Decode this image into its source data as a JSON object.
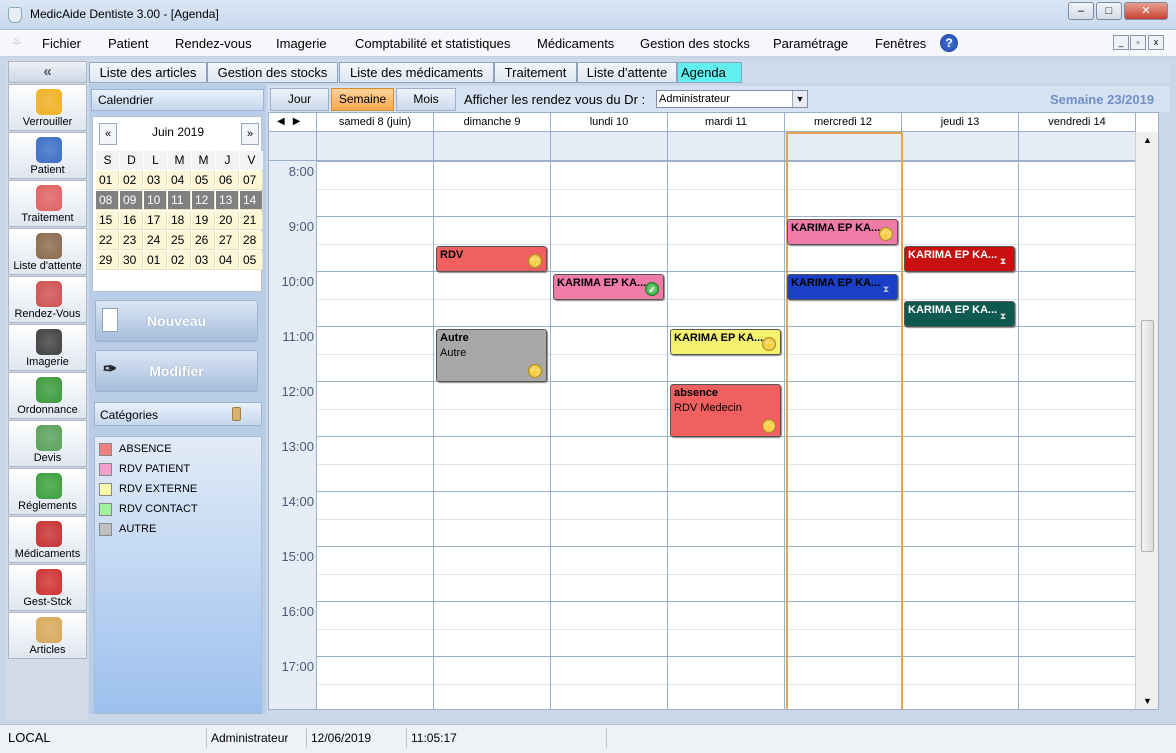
{
  "window": {
    "title": "MedicAide Dentiste 3.00  - [Agenda]",
    "min": "–",
    "max": "□",
    "close": "✕"
  },
  "menu": {
    "items": [
      "Fichier",
      "Patient",
      "Rendez-vous",
      "Imagerie",
      "Comptabilité et statistiques",
      "Médicaments",
      "Gestion des stocks",
      "Paramétrage",
      "Fenêtres"
    ],
    "help": "?",
    "mdi_min": "_",
    "mdi_restore": "▫",
    "mdi_close": "x"
  },
  "sidebar": {
    "collapse": "«",
    "items": [
      {
        "label": "Verrouiller",
        "icon": "lock-icon",
        "color": "#f0b020"
      },
      {
        "label": "Patient",
        "icon": "patient-icon",
        "color": "#3a6ec4"
      },
      {
        "label": "Traitement",
        "icon": "doctor-icon",
        "color": "#e06060"
      },
      {
        "label": "Liste d'attente",
        "icon": "hourglass-icon",
        "color": "#8a6a4a"
      },
      {
        "label": "Rendez-Vous",
        "icon": "calendar-clock-icon",
        "color": "#d05050"
      },
      {
        "label": "Imagerie",
        "icon": "film-icon",
        "color": "#404040"
      },
      {
        "label": "Ordonnance",
        "icon": "caduceus-icon",
        "color": "#3a9a3a"
      },
      {
        "label": "Devis",
        "icon": "quote-icon",
        "color": "#5aa05a"
      },
      {
        "label": "Réglements",
        "icon": "money-icon",
        "color": "#3aa03a"
      },
      {
        "label": "Médicaments",
        "icon": "medicine-book-icon",
        "color": "#c83030"
      },
      {
        "label": "Gest-Stck",
        "icon": "recycle-icon",
        "color": "#d03030"
      },
      {
        "label": "Articles",
        "icon": "box-icon",
        "color": "#d8a858"
      }
    ]
  },
  "tabs": [
    {
      "label": "Liste des articles"
    },
    {
      "label": "Gestion des stocks"
    },
    {
      "label": "Liste des médicaments"
    },
    {
      "label": "Traitement"
    },
    {
      "label": "Liste d'attente"
    },
    {
      "label": "Agenda",
      "active": true
    }
  ],
  "calendar": {
    "header": "Calendrier",
    "prev": "«",
    "next": "»",
    "month": "Juin 2019",
    "weekdays": [
      "S",
      "D",
      "L",
      "M",
      "M",
      "J",
      "V"
    ],
    "weeks": [
      [
        "01",
        "02",
        "03",
        "04",
        "05",
        "06",
        "07"
      ],
      [
        "08",
        "09",
        "10",
        "11",
        "12",
        "13",
        "14"
      ],
      [
        "15",
        "16",
        "17",
        "18",
        "19",
        "20",
        "21"
      ],
      [
        "22",
        "23",
        "24",
        "25",
        "26",
        "27",
        "28"
      ],
      [
        "29",
        "30",
        "01",
        "02",
        "03",
        "04",
        "05"
      ]
    ],
    "selected_week": 1
  },
  "buttons": {
    "new": "Nouveau",
    "edit": "Modifier"
  },
  "categories": {
    "header": "Catégories",
    "items": [
      {
        "label": "ABSENCE",
        "color": "#f08080"
      },
      {
        "label": "RDV PATIENT",
        "color": "#f4a0cc"
      },
      {
        "label": "RDV EXTERNE",
        "color": "#fafaaa"
      },
      {
        "label": "RDV CONTACT",
        "color": "#a0f0a0"
      },
      {
        "label": "AUTRE",
        "color": "#c0c0c0"
      }
    ]
  },
  "views": {
    "day": "Jour",
    "week": "Semaine",
    "month": "Mois",
    "active": "week"
  },
  "doctor": {
    "label": "Afficher les rendez vous du Dr :",
    "value": "Administrateur"
  },
  "week_label": "Semaine 23/2019",
  "agenda": {
    "nav": "◀▶",
    "days": [
      "samedi 8 (juin)",
      "dimanche 9",
      "lundi 10",
      "mardi 11",
      "mercredi 12",
      "jeudi 13",
      "vendredi 14"
    ],
    "today_index": 4,
    "hours": [
      "8:00",
      "9:00",
      "10:00",
      "11:00",
      "12:00",
      "13:00",
      "14:00",
      "15:00",
      "16:00",
      "17:00"
    ],
    "start_hour": 7.5,
    "appointments": [
      {
        "day": 1,
        "start": 9.5,
        "end": 10.0,
        "title": "RDV",
        "subtitle": "",
        "color": "#f06060",
        "status": "clock",
        "text_color": "#000"
      },
      {
        "day": 1,
        "start": 11.0,
        "end": 12.0,
        "title": "Autre",
        "subtitle": "Autre",
        "color": "#a8a8a8",
        "status": "clock",
        "text_color": "#000"
      },
      {
        "day": 2,
        "start": 10.0,
        "end": 10.5,
        "title": "KARIMA EP KA...",
        "subtitle": "",
        "color": "#f07aa8",
        "status": "check",
        "text_color": "#000"
      },
      {
        "day": 3,
        "start": 11.0,
        "end": 11.5,
        "title": "KARIMA EP KA...",
        "subtitle": "",
        "color": "#f4f070",
        "status": "clock",
        "text_color": "#000"
      },
      {
        "day": 3,
        "start": 12.0,
        "end": 13.0,
        "title": "absence",
        "subtitle": "RDV Medecin",
        "color": "#f06060",
        "status": "clock",
        "text_color": "#000"
      },
      {
        "day": 4,
        "start": 9.0,
        "end": 9.5,
        "title": "KARIMA EP KA...",
        "subtitle": "",
        "color": "#f07aa8",
        "status": "clock",
        "text_color": "#000"
      },
      {
        "day": 4,
        "start": 10.0,
        "end": 10.5,
        "title": "KARIMA EP KA...",
        "subtitle": "",
        "color": "#1a40c8",
        "status": "hourglass",
        "text_color": "#000"
      },
      {
        "day": 5,
        "start": 9.5,
        "end": 10.0,
        "title": "KARIMA EP KA...",
        "subtitle": "",
        "color": "#c81010",
        "status": "hourglass",
        "text_color": "#fff"
      },
      {
        "day": 5,
        "start": 10.5,
        "end": 11.0,
        "title": "KARIMA EP KA...",
        "subtitle": "",
        "color": "#0f5a50",
        "status": "hourglass",
        "text_color": "#fff"
      }
    ]
  },
  "status": {
    "location": "LOCAL",
    "user": "Administrateur",
    "date": "12/06/2019",
    "time": "11:05:17"
  }
}
